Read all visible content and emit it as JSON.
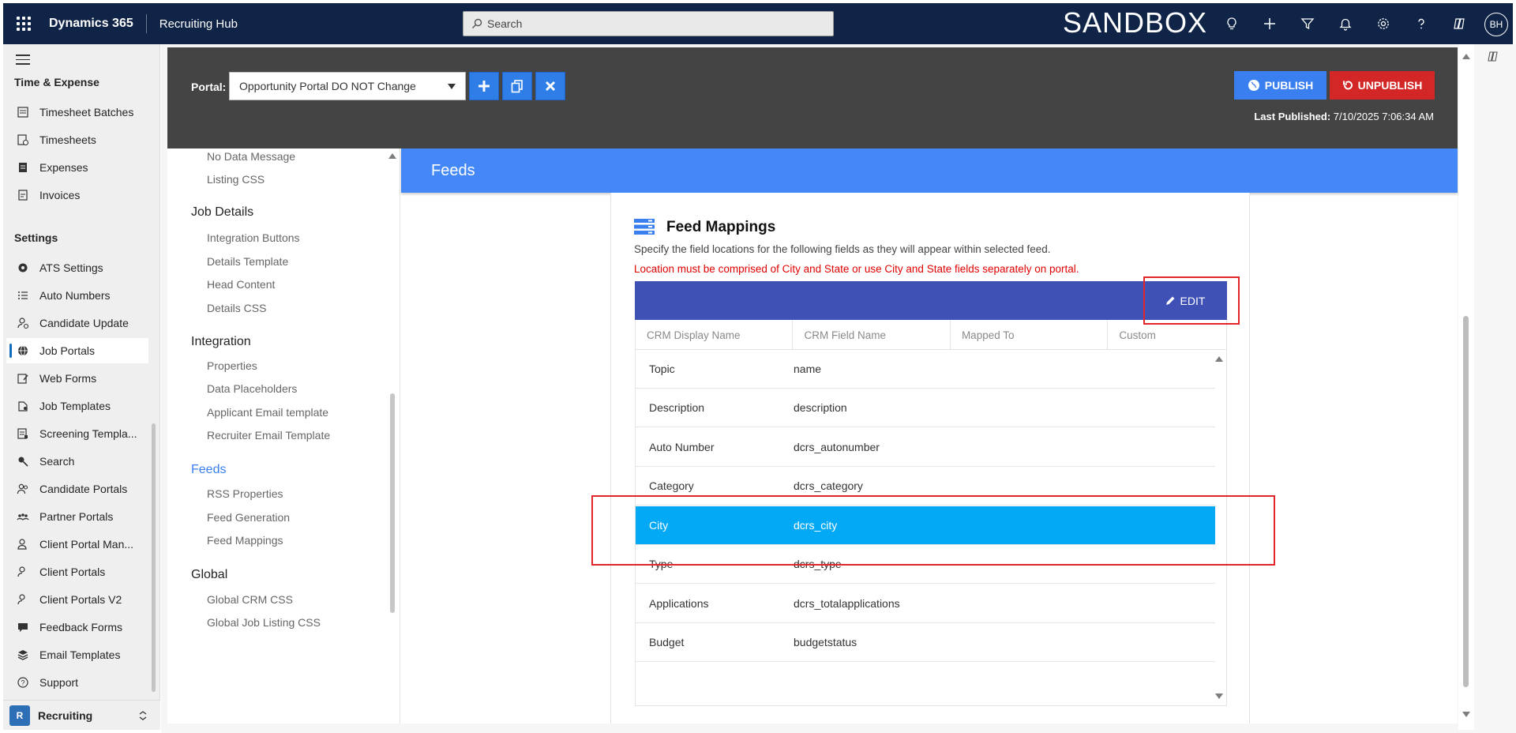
{
  "topbar": {
    "brand": "Dynamics 365",
    "app": "Recruiting Hub",
    "search_placeholder": "Search",
    "env_label": "SANDBOX",
    "avatar_initials": "BH"
  },
  "leftnav": {
    "section_time": "Time & Expense",
    "time_items": [
      "Timesheet Batches",
      "Timesheets",
      "Expenses",
      "Invoices"
    ],
    "section_settings": "Settings",
    "settings_items": [
      "ATS Settings",
      "Auto Numbers",
      "Candidate Update",
      "Job Portals",
      "Web Forms",
      "Job Templates",
      "Screening Templa...",
      "Search",
      "Candidate Portals",
      "Partner Portals",
      "Client Portal Man...",
      "Client Portals",
      "Client Portals V2",
      "Feedback Forms",
      "Email Templates",
      "Support"
    ],
    "active_item": "Job Portals",
    "area_badge": "R",
    "area_name": "Recruiting"
  },
  "portalbar": {
    "label": "Portal:",
    "selected_portal": "Opportunity Portal DO NOT Change",
    "publish_label": "PUBLISH",
    "unpublish_label": "UNPUBLISH",
    "last_published_label": "Last Published:",
    "last_published_value": "7/10/2025 7:06:34 AM"
  },
  "subnav": {
    "items_top": [
      "No Data Message",
      "Listing CSS"
    ],
    "job_details_head": "Job Details",
    "job_details_items": [
      "Integration Buttons",
      "Details Template",
      "Head Content",
      "Details CSS"
    ],
    "integration_head": "Integration",
    "integration_items": [
      "Properties",
      "Data Placeholders",
      "Applicant Email template",
      "Recruiter Email Template"
    ],
    "feeds_head": "Feeds",
    "feeds_items": [
      "RSS Properties",
      "Feed Generation",
      "Feed Mappings"
    ],
    "global_head": "Global",
    "global_items": [
      "Global CRM CSS",
      "Global Job Listing CSS"
    ]
  },
  "content": {
    "banner": "Feeds",
    "card_title": "Feed Mappings",
    "card_subtitle": "Specify the field locations for the following fields as they will appear within selected feed.",
    "card_warning": "Location must be comprised of City and State or use City and State fields separately on portal.",
    "edit_label": "EDIT",
    "columns": [
      "CRM Display Name",
      "CRM Field Name",
      "Mapped To",
      "Custom"
    ],
    "rows": [
      {
        "display": "Topic",
        "field": "name"
      },
      {
        "display": "Description",
        "field": "description"
      },
      {
        "display": "Auto Number",
        "field": "dcrs_autonumber"
      },
      {
        "display": "Category",
        "field": "dcrs_category"
      },
      {
        "display": "City",
        "field": "dcrs_city"
      },
      {
        "display": "Type",
        "field": "dcrs_type"
      },
      {
        "display": "Applications",
        "field": "dcrs_totalapplications"
      },
      {
        "display": "Budget",
        "field": "budgetstatus"
      }
    ],
    "selected_row": "City"
  },
  "colors": {
    "topbar": "#0f2446",
    "banner": "#4488f8",
    "grid_header": "#3f51b5",
    "selected_row": "#03a9f4",
    "publish": "#3a7ff0",
    "unpublish": "#d32727",
    "highlight_box": "#e0262b"
  }
}
